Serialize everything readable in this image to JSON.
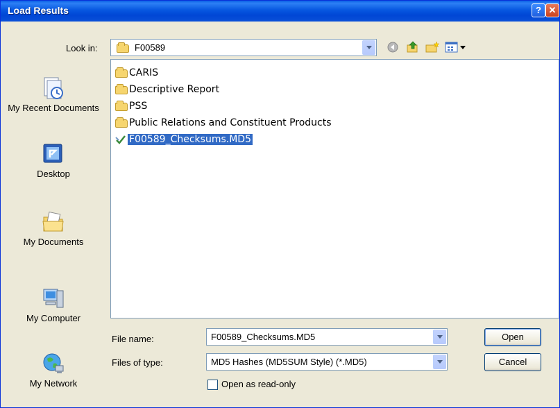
{
  "window": {
    "title": "Load Results"
  },
  "lookin": {
    "label": "Look in:",
    "value": "F00589"
  },
  "places": [
    {
      "label": "My Recent Documents",
      "icon": "recent-documents-icon"
    },
    {
      "label": "Desktop",
      "icon": "desktop-icon"
    },
    {
      "label": "My Documents",
      "icon": "my-documents-icon"
    },
    {
      "label": "My Computer",
      "icon": "my-computer-icon"
    },
    {
      "label": "My Network",
      "icon": "my-network-icon"
    }
  ],
  "files": [
    {
      "name": "CARIS",
      "type": "folder"
    },
    {
      "name": "Descriptive Report",
      "type": "folder"
    },
    {
      "name": "PSS",
      "type": "folder"
    },
    {
      "name": "Public Relations and Constituent Products",
      "type": "folder"
    },
    {
      "name": "F00589_Checksums.MD5",
      "type": "md5-file",
      "selected": true
    }
  ],
  "filename": {
    "label": "File name:",
    "value": "F00589_Checksums.MD5"
  },
  "filetype": {
    "label": "Files of type:",
    "value": "MD5 Hashes (MD5SUM Style) (*.MD5)"
  },
  "readonly": {
    "label": "Open as read-only",
    "checked": false
  },
  "buttons": {
    "open": "Open",
    "cancel": "Cancel"
  },
  "colors": {
    "title_bar": "#0054e3",
    "selection": "#316ac5",
    "dialog_bg": "#ece9d8"
  }
}
